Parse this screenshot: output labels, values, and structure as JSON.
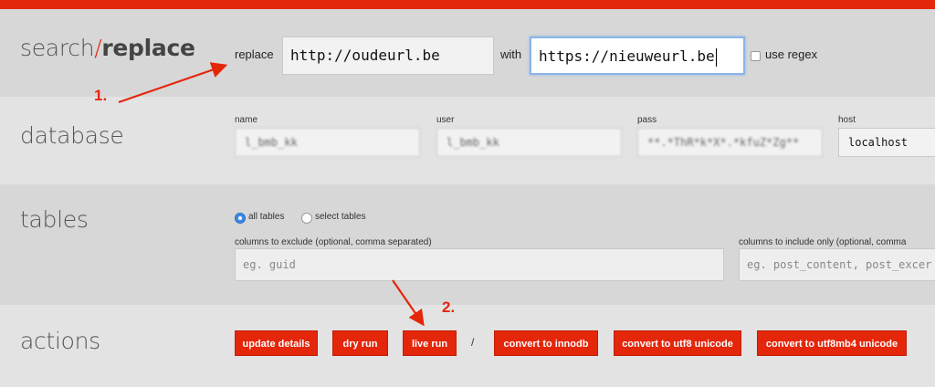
{
  "sections": {
    "search": {
      "title_a": "search",
      "title_slash": "/",
      "title_b": "replace"
    },
    "database": {
      "title": "database"
    },
    "tables": {
      "title": "tables"
    },
    "actions": {
      "title": "actions"
    }
  },
  "search": {
    "replace_label": "replace",
    "replace_value": "http://oudeurl.be",
    "with_label": "with",
    "with_value": "https://nieuweurl.be",
    "use_regex_label": "use regex",
    "use_regex_checked": false
  },
  "database": {
    "name_label": "name",
    "name_value": "l_bmb_kk",
    "user_label": "user",
    "user_value": "l_bmb_kk",
    "pass_label": "pass",
    "pass_value": "**.*ThR*k*X*.*kfuZ*Zg**",
    "host_label": "host",
    "host_value": "localhost"
  },
  "tables": {
    "all_tables_label": "all tables",
    "select_tables_label": "select tables",
    "selected": "all tables",
    "exclude_label": "columns to exclude (optional, comma separated)",
    "exclude_placeholder": "eg. guid",
    "include_label": "columns to include only (optional, comma",
    "include_placeholder": "eg. post_content, post_excer"
  },
  "actions": {
    "update_details": "update details",
    "dry_run": "dry run",
    "live_run": "live run",
    "separator": "/",
    "convert_innodb": "convert to innodb",
    "convert_utf8": "convert to utf8 unicode",
    "convert_utf8mb4": "convert to utf8mb4 unicode"
  },
  "annotations": {
    "step1": "1.",
    "step2": "2."
  },
  "colors": {
    "accent": "#e4260b",
    "focus": "#8ab4e8",
    "radio_on": "#3d8ae6"
  }
}
